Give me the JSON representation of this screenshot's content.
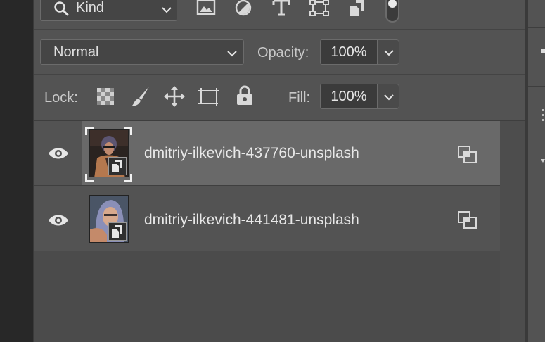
{
  "filter_bar": {
    "kind_label": "Kind",
    "filter_icons": [
      "image-filter-icon",
      "adjustment-filter-icon",
      "type-filter-icon",
      "shape-filter-icon",
      "smart-object-filter-icon"
    ]
  },
  "blend": {
    "mode": "Normal",
    "opacity_label": "Opacity:",
    "opacity_value": "100%"
  },
  "lock": {
    "label": "Lock:",
    "fill_label": "Fill:",
    "fill_value": "100%"
  },
  "layers": [
    {
      "name": "dmitriy-ilkevich-437760-unsplash",
      "visible": true,
      "selected": true
    },
    {
      "name": "dmitriy-ilkevich-441481-unsplash",
      "visible": true,
      "selected": false
    }
  ],
  "colors": {
    "panel": "#535353",
    "selected_row": "#6a6a6a",
    "field": "#3b3b3b"
  }
}
